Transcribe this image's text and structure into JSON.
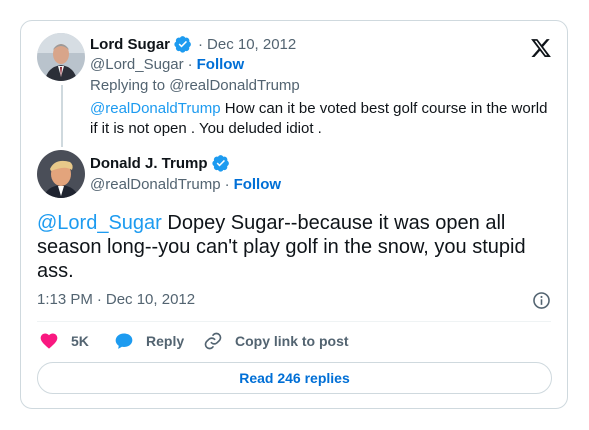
{
  "reply_tweet": {
    "author_name": "Lord Sugar",
    "date": "Dec 10, 2012",
    "handle": "@Lord_Sugar",
    "follow_label": "Follow",
    "replying_to_prefix": "Replying to",
    "replying_to_handle": "@realDonaldTrump",
    "mention": "@realDonaldTrump",
    "text": " How can it be voted best golf course in the world if it is not open . You deluded idiot ."
  },
  "main_tweet": {
    "author_name": "Donald J. Trump",
    "handle": "@realDonaldTrump",
    "follow_label": "Follow",
    "mention": "@Lord_Sugar",
    "text": " Dopey Sugar--because it was open all season long--you can't play golf in the snow, you stupid ass.",
    "time": "1:13 PM",
    "date": "Dec 10, 2012"
  },
  "actions": {
    "likes_count": "5K",
    "reply_label": "Reply",
    "copy_link_label": "Copy link to post"
  },
  "read_replies_label": "Read 246 replies",
  "separator_dot": "·",
  "colors": {
    "link": "#1d9bf0",
    "follow": "#006fd6",
    "like": "#f91880",
    "reply_icon": "#1d9bf0",
    "muted": "#536471",
    "border": "#cfd9de"
  },
  "icons": {
    "brand": "x-logo-icon",
    "verified": "verified-badge-icon",
    "like": "heart-icon",
    "reply": "speech-bubble-icon",
    "copy_link": "link-icon",
    "info": "info-icon"
  }
}
